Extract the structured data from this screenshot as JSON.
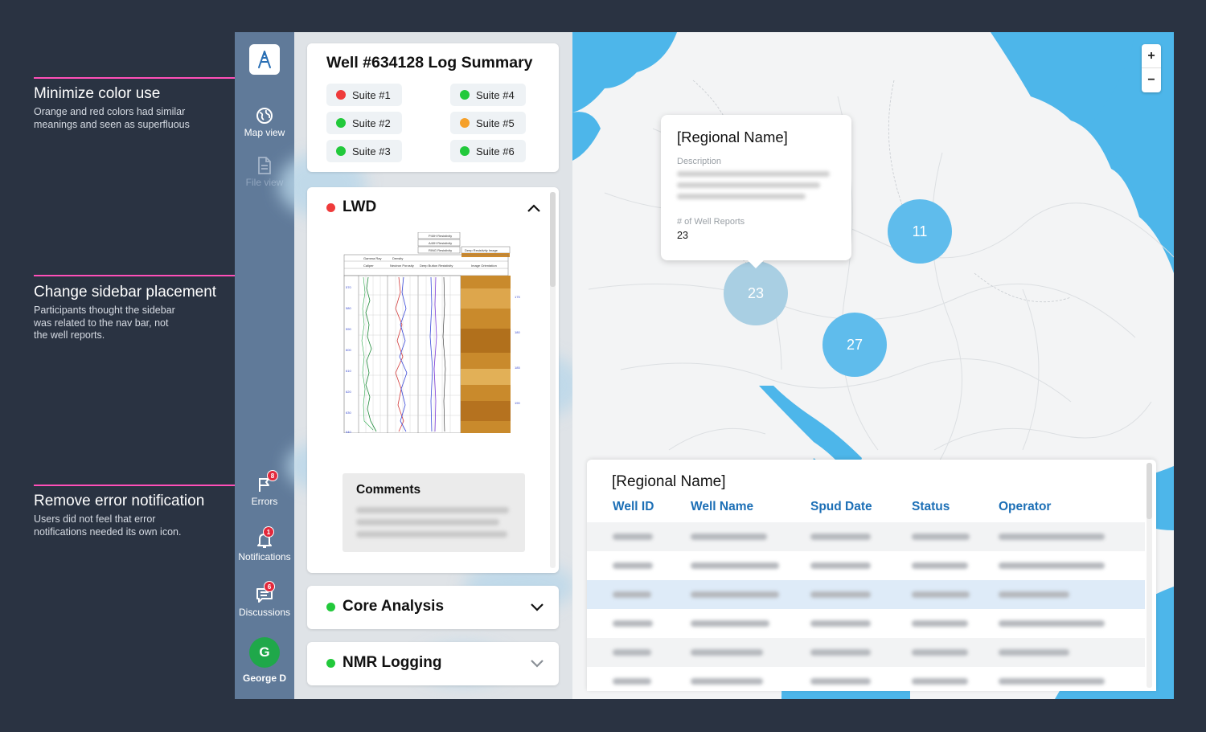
{
  "annotations": [
    {
      "heading": "Minimize color use",
      "desc": [
        "Orange and red colors had similar",
        "meanings and seen as superfluous"
      ]
    },
    {
      "heading": "Change sidebar placement",
      "desc": [
        "Participants thought the sidebar",
        "was related to the nav bar, not",
        "the well reports."
      ]
    },
    {
      "heading": "Remove error notification",
      "desc": [
        "Users did not feel that error",
        "notifications needed its own icon."
      ]
    }
  ],
  "sidebar": {
    "logo_icon": "drilling-rig-icon",
    "items": [
      {
        "label": "Map view",
        "icon": "globe-icon",
        "badge": ""
      },
      {
        "label": "File view",
        "icon": "file-icon",
        "badge": ""
      },
      {
        "label": "Errors",
        "icon": "flag-icon",
        "badge": "8"
      },
      {
        "label": "Notifications",
        "icon": "bell-icon",
        "badge": "1"
      },
      {
        "label": "Discussions",
        "icon": "chat-icon",
        "badge": "6"
      }
    ],
    "user": {
      "initial": "G",
      "name": "George D"
    }
  },
  "summary": {
    "title": "Well #634128 Log Summary",
    "suites": [
      {
        "label": "Suite #1",
        "color": "#ef3b3b"
      },
      {
        "label": "Suite #2",
        "color": "#22c93b"
      },
      {
        "label": "Suite #3",
        "color": "#22c93b"
      },
      {
        "label": "Suite #4",
        "color": "#22c93b"
      },
      {
        "label": "Suite #5",
        "color": "#f5a02a"
      },
      {
        "label": "Suite #6",
        "color": "#22c93b"
      }
    ]
  },
  "sections": [
    {
      "label": "LWD",
      "color": "#ef3b3b",
      "expanded": true
    },
    {
      "label": "Core Analysis",
      "color": "#22c93b",
      "expanded": false
    },
    {
      "label": "NMR Logging",
      "color": "#22c93b",
      "expanded": false
    }
  ],
  "log": {
    "headers": [
      "P40H Resistivity",
      "A40H Resistivity",
      "RING Resistivity",
      "Deep Resistivity Image",
      "Gamma Ray",
      "Density",
      "Caliper",
      "Neutron Porosity",
      "Deep Button Resistivity",
      "Image Orientation"
    ],
    "depth_ticks": [
      "570",
      "580",
      "590",
      "600",
      "610",
      "620",
      "630",
      "640"
    ],
    "right_ticks": [
      "175",
      "180",
      "185",
      "190"
    ]
  },
  "comments": {
    "title": "Comments"
  },
  "map": {
    "zoom_in": "+",
    "zoom_out": "−",
    "clusters": [
      {
        "count": "23",
        "color": "#a9cfe3"
      },
      {
        "count": "11",
        "color": "#5fbcec"
      },
      {
        "count": "27",
        "color": "#5fbcec"
      }
    ],
    "popup": {
      "title": "[Regional Name]",
      "description_label": "Description",
      "reports_label": "# of Well Reports",
      "reports_value": "23"
    }
  },
  "table": {
    "title": "[Regional Name]",
    "columns": [
      "Well ID",
      "Well Name",
      "Spud Date",
      "Status",
      "Operator"
    ],
    "rows": 6,
    "highlighted_row": 3
  },
  "colors": {
    "accent": "#1c6fb6",
    "sidebar": "#607a99",
    "water": "#4db6ea",
    "annotation": "#ff4fb8"
  }
}
